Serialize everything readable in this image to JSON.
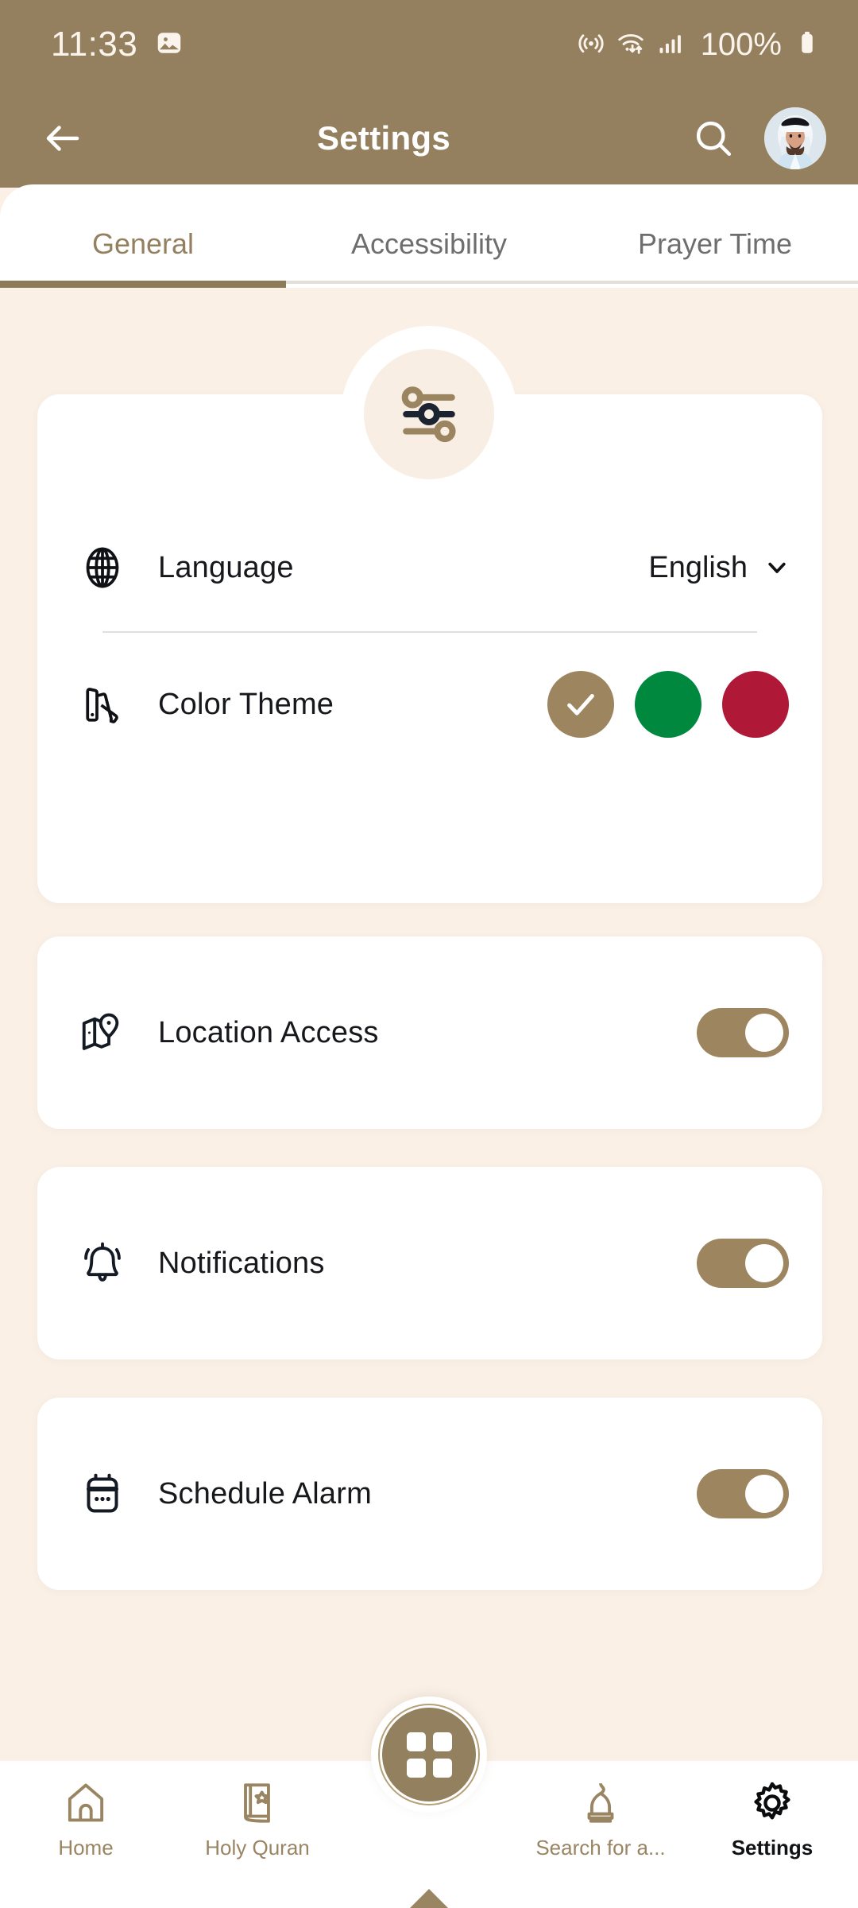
{
  "status_bar": {
    "time": "11:33",
    "battery_percent": "100%",
    "icons": [
      "screenshot-icon",
      "hotspot-icon",
      "wifi-icon",
      "signal-icon",
      "battery-icon"
    ]
  },
  "header": {
    "title": "Settings",
    "back_icon": "arrow-left-icon",
    "search_icon": "search-icon",
    "avatar_icon": "user-avatar"
  },
  "tabs": {
    "items": [
      {
        "label": "General",
        "active": true
      },
      {
        "label": "Accessibility",
        "active": false
      },
      {
        "label": "Prayer Time",
        "active": false
      }
    ]
  },
  "hero": {
    "icon": "sliders-icon"
  },
  "settings": {
    "general_card": {
      "language": {
        "icon": "globe-icon",
        "label": "Language",
        "value": "English",
        "chevron": "chevron-down-icon"
      },
      "color_theme": {
        "icon": "palette-icon",
        "label": "Color Theme",
        "selected_index": 0,
        "swatches": [
          {
            "name": "brown",
            "color": "#9C855F",
            "selected": true
          },
          {
            "name": "green",
            "color": "#00883F",
            "selected": false
          },
          {
            "name": "red",
            "color": "#B01838",
            "selected": false
          }
        ]
      }
    },
    "location_access": {
      "icon": "map-pin-icon",
      "label": "Location Access",
      "toggle": "on"
    },
    "notifications": {
      "icon": "bell-icon",
      "label": "Notifications",
      "toggle": "on"
    },
    "schedule_alarm": {
      "icon": "calendar-icon",
      "label": "Schedule Alarm",
      "toggle": "on"
    }
  },
  "bottom_nav": {
    "items": [
      {
        "label": "Home",
        "icon": "home-icon",
        "active": false
      },
      {
        "label": "Holy Quran",
        "icon": "book-icon",
        "active": false
      },
      {
        "label": "Search for a...",
        "icon": "mosque-icon",
        "active": false
      },
      {
        "label": "Settings",
        "icon": "gear-icon",
        "active": true
      }
    ],
    "fab": {
      "icon": "grid-icon"
    }
  },
  "colors": {
    "brand_brown": "#94805F",
    "background": "#FAF0E6",
    "card": "#FFFFFF",
    "accent_green": "#00883F",
    "accent_red": "#B01838",
    "text_dark": "#16181C"
  }
}
